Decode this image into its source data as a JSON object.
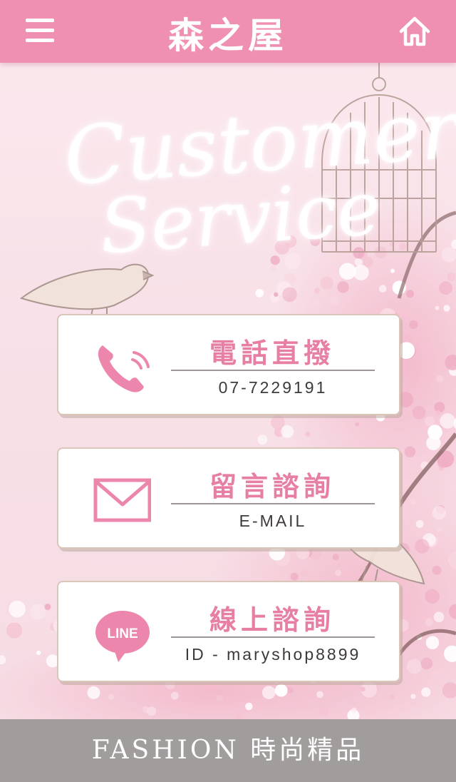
{
  "header": {
    "logo": "森之屋",
    "menu_icon": "hamburger-menu-icon",
    "home_icon": "home-icon"
  },
  "hero": {
    "line1": "Customer",
    "line2": "Service"
  },
  "cards": [
    {
      "title": "電話直撥",
      "sub": "07-7229191",
      "icon": "phone-icon"
    },
    {
      "title": "留言諮詢",
      "sub": "E-MAIL",
      "icon": "envelope-icon"
    },
    {
      "title": "線上諮詢",
      "sub": "ID - maryshop8899",
      "icon": "line-chat-icon",
      "icon_text": "LINE"
    }
  ],
  "footer": {
    "text": "FASHION 時尚精品"
  },
  "colors": {
    "header": "#ef8fb2",
    "accent": "#e77ea4",
    "footer": "#a09d9c",
    "border": "#d9c6b8"
  }
}
